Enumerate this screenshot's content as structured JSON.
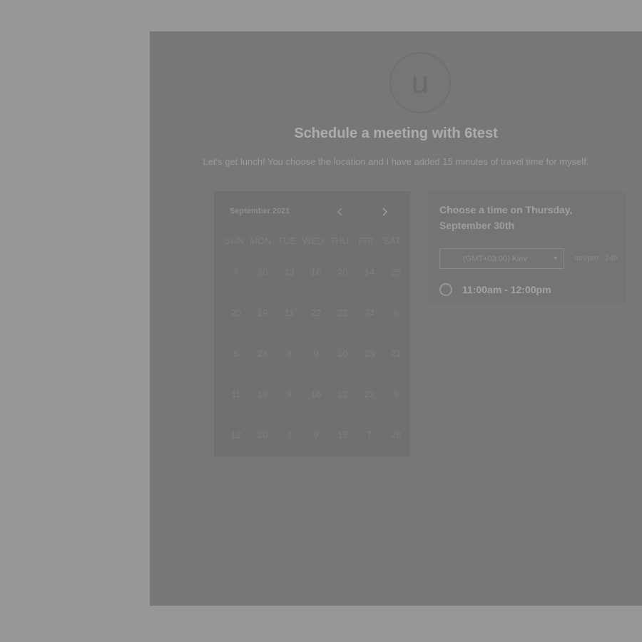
{
  "page": {
    "avatar_initial": "u",
    "title": "Schedule a meeting with 6test",
    "description": "Let's get lunch! You choose the location and I have added 15 minutes of travel time for myself."
  },
  "calendar": {
    "month_label": "September 2021",
    "prev_icon": "chevron-left-icon",
    "next_icon": "chevron-right-icon",
    "weekdays": [
      "SUN",
      "MON",
      "TUE",
      "WED",
      "THU",
      "FRI",
      "SAT"
    ],
    "weeks": [
      [
        "7",
        "20",
        "13",
        "16",
        "20",
        "14",
        "25"
      ],
      [
        "20",
        "19",
        "11",
        "22",
        "22",
        "24",
        "6"
      ],
      [
        "5",
        "24",
        "8",
        "9",
        "10",
        "23",
        "21"
      ],
      [
        "11",
        "19",
        "9",
        "16",
        "12",
        "22",
        "9"
      ],
      [
        "12",
        "20",
        "3",
        "9",
        "15",
        "7",
        "28"
      ]
    ]
  },
  "times": {
    "heading": "Choose a time on Thursday, September 30th",
    "timezone": "(GMT+03:00) Kiev",
    "format_12h": "am/pm",
    "format_24h": "24h",
    "slots": [
      "11:00am - 12:00pm"
    ]
  },
  "colors": {
    "overlay": "#979797",
    "panel": "#777777",
    "title_text": "#adadad"
  }
}
